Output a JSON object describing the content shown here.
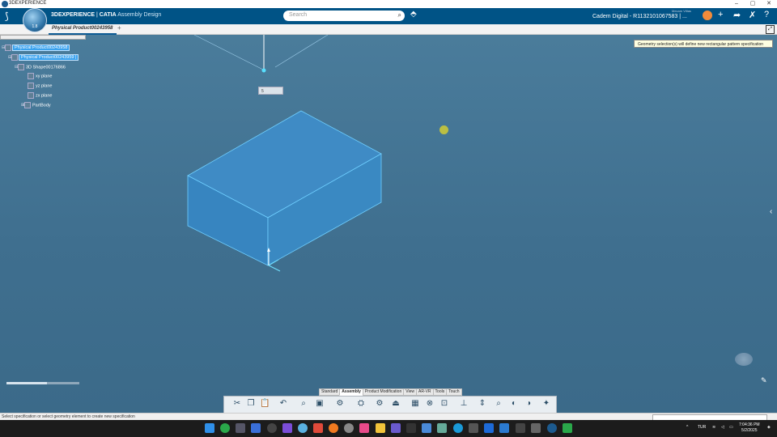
{
  "window": {
    "title": "3DEXPERIENCE",
    "controls": [
      "–",
      "▢",
      "✕"
    ]
  },
  "header": {
    "brand_bold": "3DEXPERIENCE",
    "brand_sep": " | ",
    "brand_product": "CATIA",
    "brand_app": "Assembly Design",
    "compass_version": "1.8",
    "search_placeholder": "Search",
    "user_small": "Mecam Viltas",
    "user_label": "Cadem Digital - R1132101067583 | ...",
    "icons": [
      "tag-icon",
      "plus-icon",
      "share-icon",
      "tools-icon",
      "help-icon"
    ]
  },
  "tabs": {
    "active": "Physical Product00243958",
    "add": "+"
  },
  "tree": {
    "root": "Physical Product00243958",
    "child": "Physical Product00243959 |",
    "shape": "3D Shape00176866",
    "planes": [
      "xy plane",
      "yz plane",
      "zx plane"
    ],
    "body": "PartBody"
  },
  "tooltip": "Geometry selection(s) will define new rectangular pattern specification",
  "spinner_value": "5",
  "toolbar": {
    "tabs": [
      "Standard",
      "Assembly",
      "Product Modification",
      "View",
      "AR-VR",
      "Tools",
      "Touch"
    ],
    "active_tab": "Assembly"
  },
  "status": {
    "message": "Select specification or select geometry element to create new specification"
  },
  "taskbar": {
    "language": "TUR",
    "time": "7:04:36 PM",
    "date": "5/2/2025"
  },
  "colors": {
    "topbar": "#005386",
    "viewport": "#4a7c9b",
    "box_top": "#3d8ac4",
    "box_edge": "#5fc8ff"
  }
}
